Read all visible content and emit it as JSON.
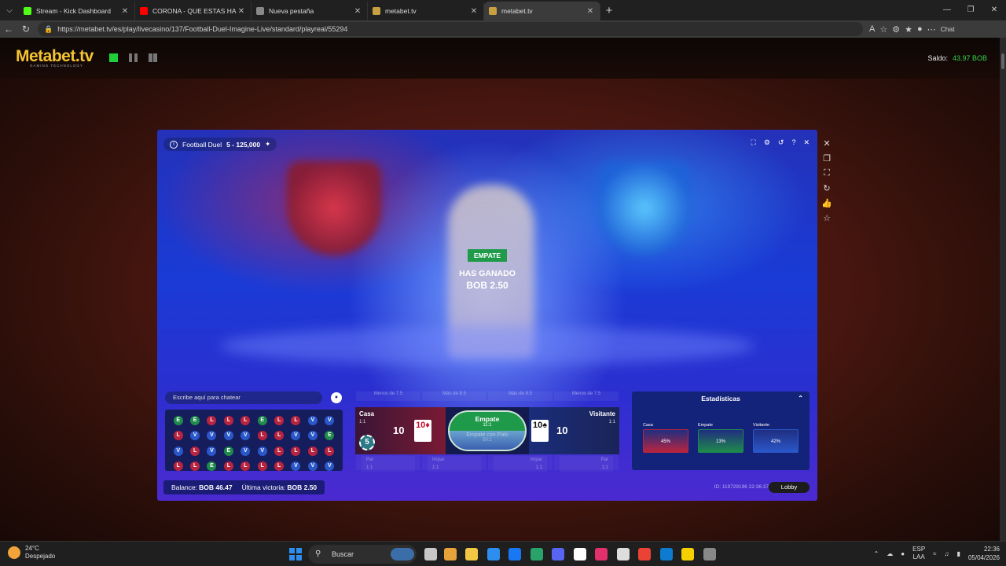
{
  "browser": {
    "tabs": [
      {
        "title": "Stream - Kick Dashboard",
        "color": "#53fc18",
        "active": false
      },
      {
        "title": "CORONA - QUE ESTAS HACIE",
        "color": "#ff0000",
        "active": false
      },
      {
        "title": "Nueva pestaña",
        "color": "#888888",
        "active": false
      },
      {
        "title": "metabet.tv",
        "color": "#c8a040",
        "active": false
      },
      {
        "title": "metabet.tv",
        "color": "#c8a040",
        "active": true
      }
    ],
    "url": "https://metabet.tv/es/play/livecasino/137/Football-Duel-Imagine-Live/standard/playreal/55294",
    "chat_label": "Chat"
  },
  "site": {
    "logo": "Metabet.tv",
    "logo_sub": "GAMING TECHNOLOGY",
    "saldo_label": "Saldo:",
    "saldo_value": "43.97 BOB"
  },
  "game": {
    "title": "Football Duel",
    "limits": "5 - 125,000",
    "result_tag": "EMPATE",
    "won_label": "HAS GANADO",
    "won_amount": "BOB 2.50",
    "chat_placeholder": "Escribe aquí para chatear",
    "odds_top": [
      "Menos de 7.5",
      "Más de 8.5",
      "Más de 8.5",
      "Menos de 7.5"
    ],
    "casa": {
      "label": "Casa",
      "odds": "1:1",
      "score": "10",
      "card": "10♦"
    },
    "visitante": {
      "label": "Visitante",
      "odds": "1:1",
      "score": "10",
      "card": "10♠"
    },
    "empate": {
      "label": "Empate",
      "odds": "11:1",
      "sub_label": "Empate con Palo",
      "sub_odds": "50:1"
    },
    "chip_value": "5",
    "odds_bottom": [
      {
        "label": "Par",
        "odds": "1:1"
      },
      {
        "label": "Impar",
        "odds": "1:1"
      },
      {
        "label": "Impar",
        "odds": "1:1"
      },
      {
        "label": "Par",
        "odds": "1:1"
      }
    ],
    "roads": [
      [
        "E",
        "E",
        "L",
        "L",
        "L",
        "E",
        "L",
        "L",
        "V",
        "V"
      ],
      [
        "L",
        "V",
        "V",
        "V",
        "V",
        "L",
        "L",
        "V",
        "V",
        "E"
      ],
      [
        "V",
        "L",
        "V",
        "E",
        "V",
        "V",
        "L",
        "L",
        "L",
        "L"
      ],
      [
        "L",
        "L",
        "E",
        "L",
        "L",
        "L",
        "L",
        "V",
        "V",
        "V"
      ]
    ],
    "stats": {
      "title": "Estadísticas",
      "items": [
        {
          "label": "Casa",
          "value": "45%",
          "color": "#b8243f"
        },
        {
          "label": "Empate",
          "value": "13%",
          "color": "#1f8a4b"
        },
        {
          "label": "Visitante",
          "value": "42%",
          "color": "#2a57c9"
        }
      ]
    },
    "balance_label": "Balance:",
    "balance_value": "BOB 46.47",
    "last_win_label": "Última victoria:",
    "last_win_value": "BOB 2.50",
    "round_id": "ID: 119729196  22:36:37",
    "lobby": "Lobby"
  },
  "taskbar": {
    "temp": "24°C",
    "weather": "Despejado",
    "search": "Buscar",
    "lang1": "ESP",
    "lang2": "LAA",
    "time": "22:36",
    "date": "05/04/2026",
    "icons": [
      "#3b6ea8",
      "#c8c8c8",
      "#e8a23a",
      "#f2c744",
      "#2d8ef0",
      "#1877f2",
      "#2aa36b",
      "#5865f2",
      "#ffffff",
      "#e1306c",
      "#dddddd",
      "#ea4335",
      "#0c7bd0",
      "#f5d000",
      "#888888"
    ]
  }
}
